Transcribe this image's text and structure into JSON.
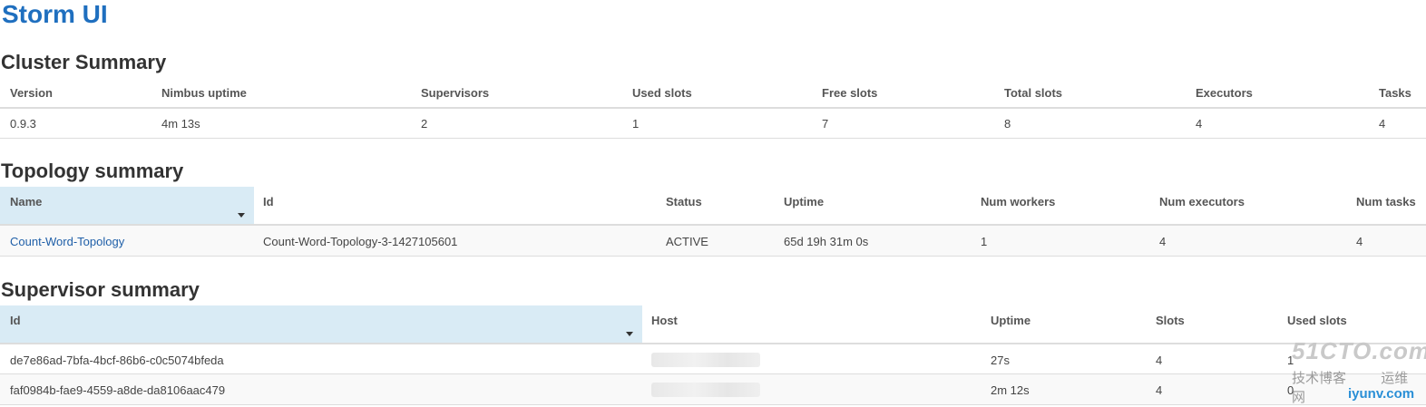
{
  "app": {
    "title": "Storm UI"
  },
  "cluster": {
    "title": "Cluster Summary",
    "headers": [
      "Version",
      "Nimbus uptime",
      "Supervisors",
      "Used slots",
      "Free slots",
      "Total slots",
      "Executors",
      "Tasks"
    ],
    "row": [
      "0.9.3",
      "4m 13s",
      "2",
      "1",
      "7",
      "8",
      "4",
      "4"
    ]
  },
  "topology": {
    "title": "Topology summary",
    "headers": [
      "Name",
      "Id",
      "Status",
      "Uptime",
      "Num workers",
      "Num executors",
      "Num tasks"
    ],
    "rows": [
      [
        "Count-Word-Topology",
        "Count-Word-Topology-3-1427105601",
        "ACTIVE",
        "65d 19h 31m 0s",
        "1",
        "4",
        "4"
      ]
    ]
  },
  "supervisor": {
    "title": "Supervisor summary",
    "headers": [
      "Id",
      "Host",
      "Uptime",
      "Slots",
      "Used slots"
    ],
    "rows": [
      [
        "de7e86ad-7bfa-4bcf-86b6-c0c5074bfeda",
        "",
        "27s",
        "4",
        "1"
      ],
      [
        "faf0984b-fae9-4559-a8de-da8106aac479",
        "",
        "2m 12s",
        "4",
        "0"
      ]
    ]
  },
  "watermark": {
    "logo": "51CTO.com",
    "tagline": "技术博客",
    "tagline2": "运维网",
    "url": "iyunv.com"
  }
}
